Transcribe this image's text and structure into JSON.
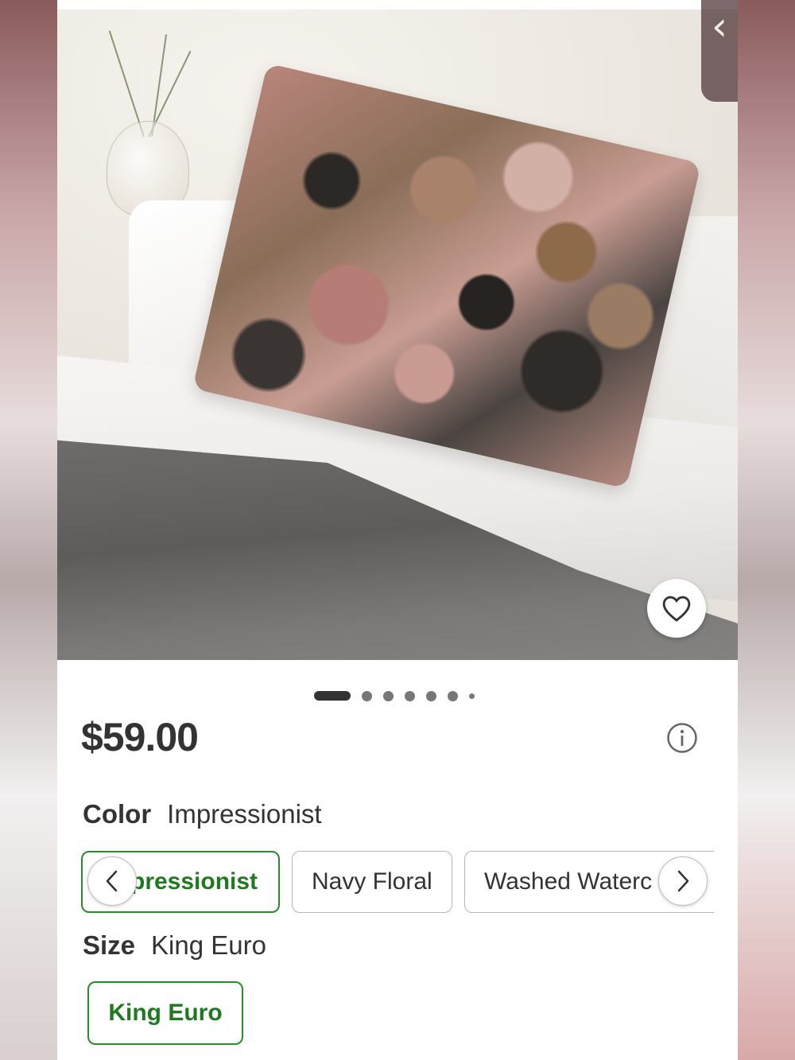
{
  "product": {
    "price": "$59.00",
    "image_alt": "Impressionist patterned pillow on bed"
  },
  "carousel": {
    "total": 7,
    "active": 1
  },
  "color": {
    "label": "Color",
    "selected": "Impressionist",
    "options": [
      {
        "label": "Impressionist",
        "display": "pressionist",
        "selected": true
      },
      {
        "label": "Navy Floral",
        "display": "Navy Floral",
        "selected": false
      },
      {
        "label": "Washed Watercolor",
        "display": "Washed Waterc",
        "selected": false
      }
    ]
  },
  "size": {
    "label": "Size",
    "selected": "King Euro",
    "options": [
      {
        "label": "King Euro",
        "selected": true
      }
    ]
  },
  "icons": {
    "back": "chevron-left-icon",
    "favorite": "heart-icon",
    "info": "info-icon",
    "prev": "chevron-left-icon",
    "next": "chevron-right-icon"
  },
  "colors": {
    "accent_green": "#2b8a2b",
    "text": "#333333"
  }
}
